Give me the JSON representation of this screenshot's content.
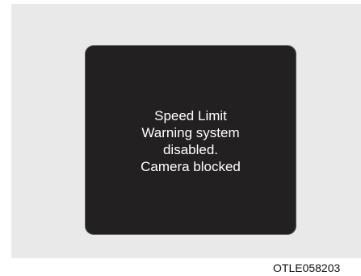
{
  "display": {
    "lines": [
      "Speed Limit",
      "Warning system",
      "disabled.",
      "Camera blocked"
    ]
  },
  "figure_code": "OTLE058203",
  "colors": {
    "background_panel": "#e9e9ea",
    "display_screen": "#222020",
    "display_text": "#ffffff"
  }
}
